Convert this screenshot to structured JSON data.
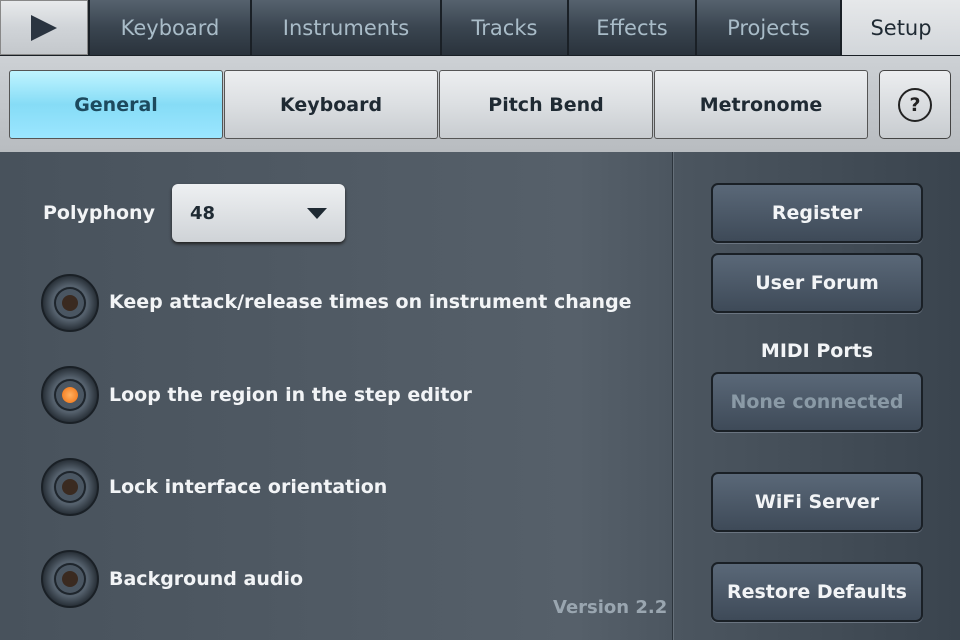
{
  "tabs": [
    "Keyboard",
    "Instruments",
    "Tracks",
    "Effects",
    "Projects",
    "Setup"
  ],
  "selected_tab": "Setup",
  "subtabs": [
    "General",
    "Keyboard",
    "Pitch Bend",
    "Metronome"
  ],
  "selected_subtab": "General",
  "help_label": "?",
  "polyphony": {
    "label": "Polyphony",
    "value": "48"
  },
  "options": [
    {
      "label": "Keep attack/release times on instrument change",
      "checked": false
    },
    {
      "label": "Loop the region in the step editor",
      "checked": true
    },
    {
      "label": "Lock interface orientation",
      "checked": false
    },
    {
      "label": "Background audio",
      "checked": false
    }
  ],
  "right": {
    "register": "Register",
    "forum": "User Forum",
    "midi_label": "MIDI Ports",
    "midi_value": "None connected",
    "wifi": "WiFi Server",
    "restore": "Restore Defaults"
  },
  "version": "Version 2.2",
  "colors": {
    "accent": "#86dcf6",
    "radio_on": "#f07010"
  }
}
